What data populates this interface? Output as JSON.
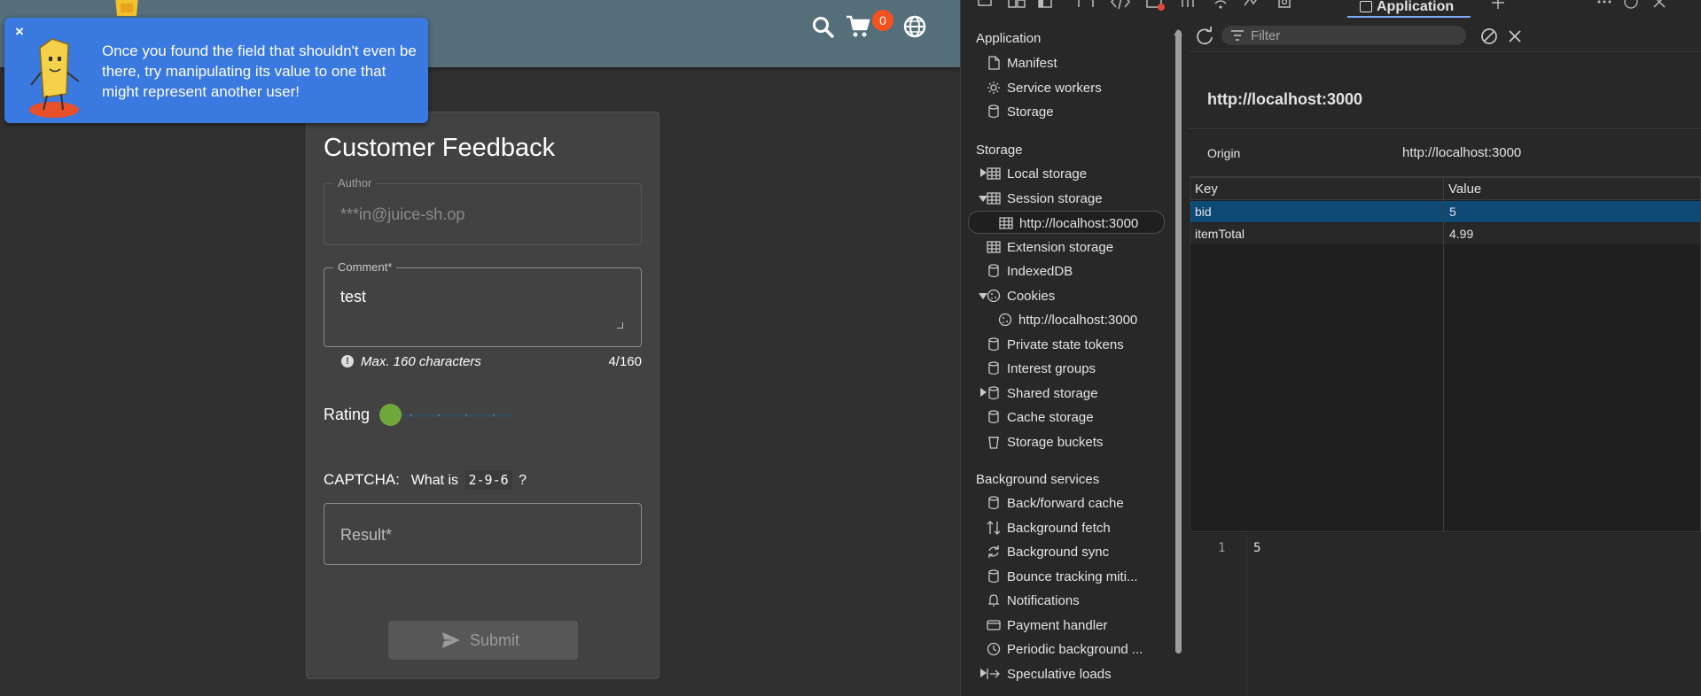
{
  "page": {
    "cart_count": "0",
    "hint": {
      "close": "×",
      "text": "Once you found the field that shouldn't even be there, try manipulating its value to one that might represent another user!"
    },
    "feedback": {
      "title": "Customer Feedback",
      "author_label": "Author",
      "author_value": "***in@juice-sh.op",
      "comment_label": "Comment*",
      "comment_value": "test",
      "max_chars": "Max. 160 characters",
      "char_count": "4/160",
      "rating_label": "Rating",
      "rating_value": "1 of 5",
      "captcha_label": "CAPTCHA:",
      "captcha_question_prefix": "What is",
      "captcha_expression": "2-9-6",
      "captcha_question_suffix": "?",
      "result_placeholder": "Result*",
      "submit_label": "Submit"
    }
  },
  "devtools": {
    "active_tab": "Application",
    "sidebar": {
      "application_heading": "Application",
      "application_items": [
        "Manifest",
        "Service workers",
        "Storage"
      ],
      "storage_heading": "Storage",
      "storage_items": [
        "Local storage",
        "Session storage",
        "http://localhost:3000",
        "Extension storage",
        "IndexedDB",
        "Cookies",
        "http://localhost:3000",
        "Private state tokens",
        "Interest groups",
        "Shared storage",
        "Cache storage",
        "Storage buckets"
      ],
      "background_heading": "Background services",
      "background_items": [
        "Back/forward cache",
        "Background fetch",
        "Background sync",
        "Bounce tracking miti...",
        "Notifications",
        "Payment handler",
        "Periodic background ...",
        "Speculative loads"
      ]
    },
    "pane": {
      "filter_placeholder": "Filter",
      "origin_title": "http://localhost:3000",
      "origin_label": "Origin",
      "origin_value": "http://localhost:3000",
      "table": {
        "headers": [
          "Key",
          "Value"
        ],
        "rows": [
          {
            "key": "bid",
            "value": "5"
          },
          {
            "key": "itemTotal",
            "value": "4.99"
          }
        ]
      },
      "preview": {
        "line_number": "1",
        "line_value": "5"
      }
    }
  }
}
